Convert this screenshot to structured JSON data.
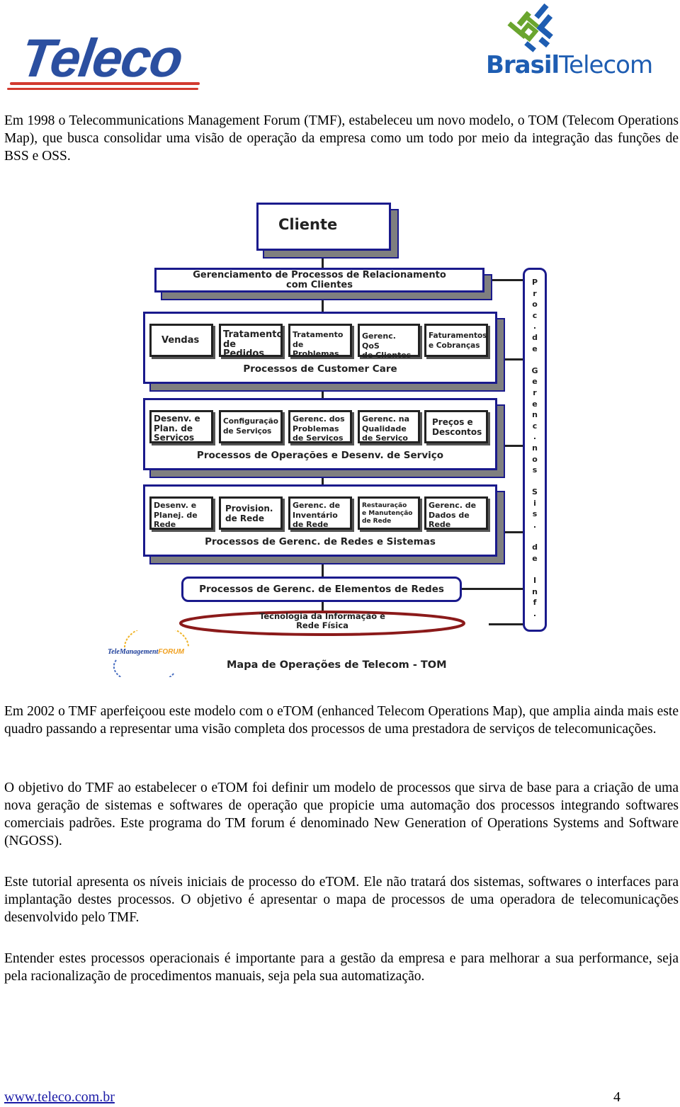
{
  "header": {
    "left_logo": {
      "text": "Teleco",
      "color": "#2b4fa0",
      "accent": "#d23a2f"
    },
    "right_logo": {
      "bold_text": "Brasil",
      "text": "Telecom",
      "color": "#1e5db2",
      "mark_colors": [
        "#1e5db2",
        "#6aa52e"
      ]
    }
  },
  "paragraphs": [
    "Em 1998 o Telecommunications Management Forum (TMF), estabeleceu um novo modelo, o TOM (Telecom Operations Map), que busca consolidar uma visão de operação da empresa como um todo por meio da integração das funções de BSS e OSS.",
    "Em 2002 o TMF aperfeiçoou este modelo com o eTOM (enhanced Telecom Operations Map), que amplia ainda mais este quadro passando a representar uma visão completa dos processos de uma prestadora de serviços de telecomunicações.",
    "O objetivo do TMF ao estabelecer o eTOM foi definir um modelo de processos que sirva de base para a criação de uma nova geração de sistemas e softwares de operação que propicie uma automação dos processos integrando softwares comerciais padrões. Este programa do TM forum é denominado New Generation of Operations Systems and Software (NGOSS).",
    "Este tutorial apresenta os níveis iniciais de processo do eTOM. Ele não tratará dos sistemas, softwares o interfaces para implantação destes processos. O objetivo é apresentar o mapa de processos de uma operadora de telecomunicações desenvolvido pelo TMF.",
    "Entender estes processos operacionais é importante para a gestão da empresa e para melhorar a sua performance, seja pela racionalização de procedimentos manuais, seja pela sua automatização."
  ],
  "diagram": {
    "client": "Cliente",
    "crm": [
      "Gerenciamento de Processos de Relacionamento",
      "com Clientes"
    ],
    "layers": [
      {
        "title": "Processos de Customer Care",
        "items": [
          [
            "Vendas"
          ],
          [
            "Tratamento",
            "de Pedidos"
          ],
          [
            "Tratamento",
            "de Problemas"
          ],
          [
            "Gerenc. QoS",
            "de Clientes"
          ],
          [
            "Faturamentos",
            "e Cobranças"
          ]
        ]
      },
      {
        "title": "Processos de Operações e Desenv. de Serviço",
        "items": [
          [
            "Desenv. e",
            "Plan. de",
            "Serviços"
          ],
          [
            "Configuração",
            "de Serviços"
          ],
          [
            "Gerenc. dos",
            "Problemas",
            "de Serviços"
          ],
          [
            "Gerenc. na",
            "Qualidade",
            "de Serviço"
          ],
          [
            "Preços e",
            "Descontos"
          ]
        ]
      },
      {
        "title": "Processos de Gerenc. de Redes e Sistemas",
        "items": [
          [
            "Desenv. e",
            "Planej. de",
            "Rede"
          ],
          [
            "Provision.",
            "de Rede"
          ],
          [
            "Gerenc. de",
            "Inventário",
            "de Rede"
          ],
          [
            "Restauração",
            "e Manutenção",
            "de Rede"
          ],
          [
            "Gerenc. de",
            "Dados de",
            "Rede"
          ]
        ]
      }
    ],
    "elements": "Processos de Gerenc. de Elementos de Redes",
    "infrastructure": [
      "Tecnologia da Informação e",
      "Rede Física"
    ],
    "side_bar_text": "Proc.de Gerenc.nos Sis. de Inf.",
    "forum_logo": {
      "text_left": "TeleManagement",
      "text_right": "FORUM"
    },
    "caption": "Mapa de Operações de Telecom - TOM",
    "colors": {
      "frame": "#1a1a8c",
      "shadow": "#7f7f7f",
      "ellipse": "#8b1a1a"
    }
  },
  "footer": {
    "link": "www.teleco.com.br",
    "page_number": "4"
  }
}
